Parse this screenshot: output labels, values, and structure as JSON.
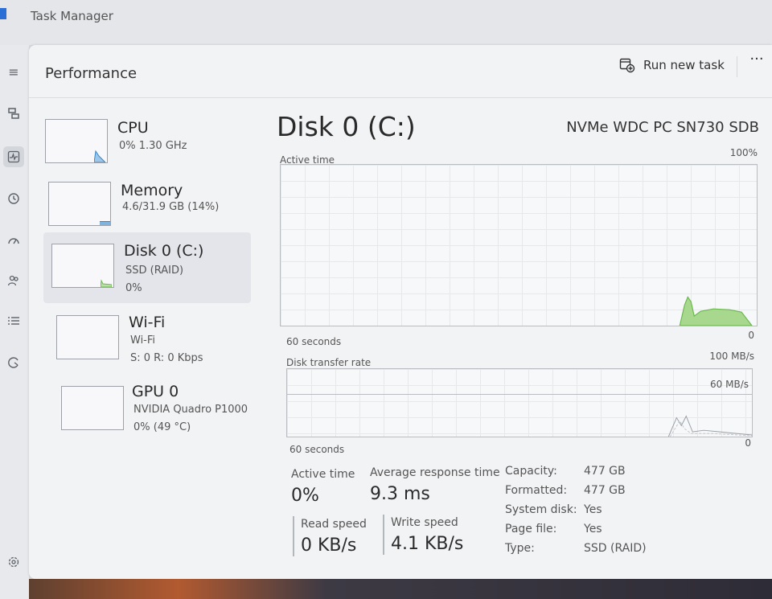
{
  "app": {
    "title": "Task Manager"
  },
  "header": {
    "page_title": "Performance",
    "run_new_task": "Run new task",
    "more": "···"
  },
  "nav": {
    "icons": [
      "hamburger-icon",
      "processes-icon",
      "performance-icon",
      "app-history-icon",
      "startup-apps-icon",
      "users-icon",
      "details-icon",
      "services-icon",
      "settings-icon"
    ],
    "active": "performance-icon"
  },
  "devices": [
    {
      "name": "CPU",
      "lines": [
        "0% 1.30 GHz"
      ]
    },
    {
      "name": "Memory",
      "lines": [
        "4.6/31.9 GB (14%)"
      ]
    },
    {
      "name": "Disk 0 (C:)",
      "lines": [
        "SSD (RAID)",
        "0%"
      ],
      "selected": true
    },
    {
      "name": "Wi-Fi",
      "lines": [
        "Wi-Fi",
        "S: 0 R: 0 Kbps"
      ]
    },
    {
      "name": "GPU 0",
      "lines": [
        "NVIDIA Quadro P1000",
        "0% (49 °C)"
      ]
    }
  ],
  "detail": {
    "title": "Disk 0 (C:)",
    "model": "NVMe WDC PC SN730 SDB",
    "active_time_graph": {
      "label": "Active time",
      "max": "100%",
      "x_label": "60 seconds",
      "min": "0"
    },
    "transfer_graph": {
      "label": "Disk transfer rate",
      "max": "100 MB/s",
      "inner": "60 MB/s",
      "x_label": "60 seconds",
      "min": "0"
    },
    "stats": {
      "active_time": {
        "label": "Active time",
        "value": "0%"
      },
      "avg_response": {
        "label": "Average response time",
        "value": "9.3 ms"
      },
      "read_speed": {
        "label": "Read speed",
        "value": "0 KB/s"
      },
      "write_speed": {
        "label": "Write speed",
        "value": "4.1 KB/s"
      }
    },
    "properties": [
      {
        "key": "Capacity:",
        "value": "477 GB"
      },
      {
        "key": "Formatted:",
        "value": "477 GB"
      },
      {
        "key": "System disk:",
        "value": "Yes"
      },
      {
        "key": "Page file:",
        "value": "Yes"
      },
      {
        "key": "Type:",
        "value": "SSD (RAID)"
      }
    ]
  },
  "colors": {
    "accent": "#5a9fd4",
    "graph_fill": "#a8d88e",
    "graph_line": "#6cb850"
  }
}
